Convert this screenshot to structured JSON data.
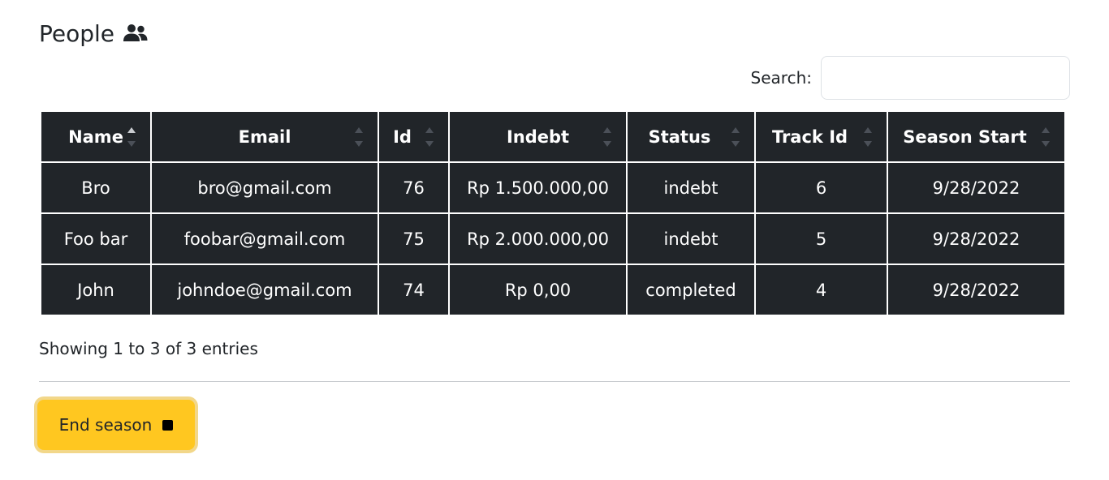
{
  "page": {
    "title": "People",
    "title_icon": "users-icon"
  },
  "search": {
    "label": "Search:",
    "value": "",
    "placeholder": ""
  },
  "table": {
    "columns": [
      "Name",
      "Email",
      "Id",
      "Indebt",
      "Status",
      "Track Id",
      "Season Start"
    ],
    "sorted_column": "Name",
    "sort_direction": "ascending",
    "rows": [
      {
        "name": "Bro",
        "email": "bro@gmail.com",
        "id": "76",
        "indebt": "Rp 1.500.000,00",
        "status": "indebt",
        "track_id": "6",
        "season_start": "9/28/2022"
      },
      {
        "name": "Foo bar",
        "email": "foobar@gmail.com",
        "id": "75",
        "indebt": "Rp 2.000.000,00",
        "status": "indebt",
        "track_id": "5",
        "season_start": "9/28/2022"
      },
      {
        "name": "John",
        "email": "johndoe@gmail.com",
        "id": "74",
        "indebt": "Rp 0,00",
        "status": "completed",
        "track_id": "4",
        "season_start": "9/28/2022"
      }
    ]
  },
  "info": {
    "text": "Showing 1 to 3 of 3 entries"
  },
  "actions": {
    "end_season_label": "End season",
    "end_season_icon": "stop-icon",
    "button_color": "#ffc720"
  },
  "colors": {
    "table_bg": "#212529",
    "table_text": "#ffffff"
  }
}
